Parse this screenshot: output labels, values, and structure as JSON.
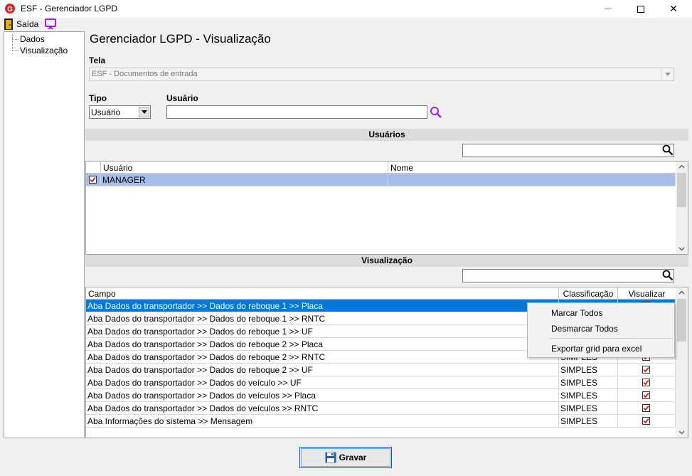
{
  "window": {
    "title": "ESF - Gerenciador LGPD",
    "minimize_glyph": "—",
    "maximize_glyph": "☐",
    "close_glyph": "✕"
  },
  "toolbar": {
    "exit_label": "Saída"
  },
  "tree": {
    "items": [
      "Dados",
      "Visualização"
    ]
  },
  "page_title": "Gerenciador LGPD - Visualização",
  "tela": {
    "label": "Tela",
    "value": "ESF - Documentos de entrada"
  },
  "tipo": {
    "label": "Tipo",
    "value": "Usuário"
  },
  "usuario": {
    "label": "Usuário",
    "value": ""
  },
  "users_section": {
    "title": "Usuários",
    "columns": [
      "Usuário",
      "Nome"
    ],
    "rows": [
      {
        "checked": true,
        "usuario": "MANAGER",
        "nome": ""
      }
    ]
  },
  "view_section": {
    "title": "Visualização",
    "columns": [
      "Campo",
      "Classificação",
      "Visualizar"
    ],
    "rows": [
      {
        "campo": "Aba Dados do transportador >> Dados do reboque 1 >> Placa",
        "classificacao": "",
        "visualizar": true
      },
      {
        "campo": "Aba Dados do transportador >> Dados do reboque 1 >> RNTC",
        "classificacao": "",
        "visualizar": true
      },
      {
        "campo": "Aba Dados do transportador >> Dados do reboque 1 >> UF",
        "classificacao": "",
        "visualizar": true
      },
      {
        "campo": "Aba Dados do transportador >> Dados do reboque 2 >> Placa",
        "classificacao": "",
        "visualizar": true
      },
      {
        "campo": "Aba Dados do transportador >> Dados do reboque 2 >> RNTC",
        "classificacao": "SIMPLES",
        "visualizar": true
      },
      {
        "campo": "Aba Dados do transportador >> Dados do reboque 2 >> UF",
        "classificacao": "SIMPLES",
        "visualizar": true
      },
      {
        "campo": "Aba Dados do transportador >> Dados do veículo >> UF",
        "classificacao": "SIMPLES",
        "visualizar": true
      },
      {
        "campo": "Aba Dados do transportador >> Dados do veículos >> Placa",
        "classificacao": "SIMPLES",
        "visualizar": true
      },
      {
        "campo": "Aba Dados do transportador >> Dados do veículos >> RNTC",
        "classificacao": "SIMPLES",
        "visualizar": true
      },
      {
        "campo": "Aba Informações do sistema >> Mensagem",
        "classificacao": "SIMPLES",
        "visualizar": true
      }
    ]
  },
  "context_menu": {
    "items": [
      "Marcar Todos",
      "Desmarcar Todos",
      "Exportar grid para excel"
    ]
  },
  "save_button": {
    "label": "Gravar"
  },
  "colors": {
    "selection": "#0078d7",
    "user_row": "#a6bde8",
    "check_red": "#d11c1c",
    "accent_purple": "#a020f0"
  }
}
